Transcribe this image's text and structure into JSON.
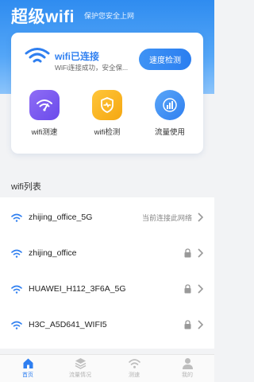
{
  "header": {
    "title": "超级wifi",
    "subtitle": "保护您安全上网"
  },
  "connection": {
    "status": "wifi已连接",
    "description": "WiFi连接成功，安全保...",
    "speed_button": "速度检测"
  },
  "tools": [
    {
      "label": "wifi测速",
      "icon": "wifi-speed-icon",
      "color": "#7b5cf0"
    },
    {
      "label": "wifi检测",
      "icon": "shield-heart-icon",
      "color": "#f5b019"
    },
    {
      "label": "流量使用",
      "icon": "chart-icon",
      "color": "#3f8ff5"
    }
  ],
  "wifi_list": {
    "title": "wifi列表",
    "items": [
      {
        "ssid": "zhijing_office_5G",
        "note": "当前连接此网络",
        "locked": false
      },
      {
        "ssid": "zhijing_office",
        "note": "",
        "locked": true
      },
      {
        "ssid": "HUAWEI_H112_3F6A_5G",
        "note": "",
        "locked": true
      },
      {
        "ssid": "H3C_A5D641_WIFI5",
        "note": "",
        "locked": true
      }
    ]
  },
  "tabbar": [
    {
      "label": "首页",
      "icon": "home-icon",
      "active": true
    },
    {
      "label": "流量情况",
      "icon": "layers-icon",
      "active": false
    },
    {
      "label": "测速",
      "icon": "wifi-icon",
      "active": false
    },
    {
      "label": "我的",
      "icon": "user-icon",
      "active": false
    }
  ],
  "colors": {
    "accent": "#2f7ff0",
    "header_gradient_top": "#2f8cf0",
    "page_bg": "#f2f3f5"
  }
}
